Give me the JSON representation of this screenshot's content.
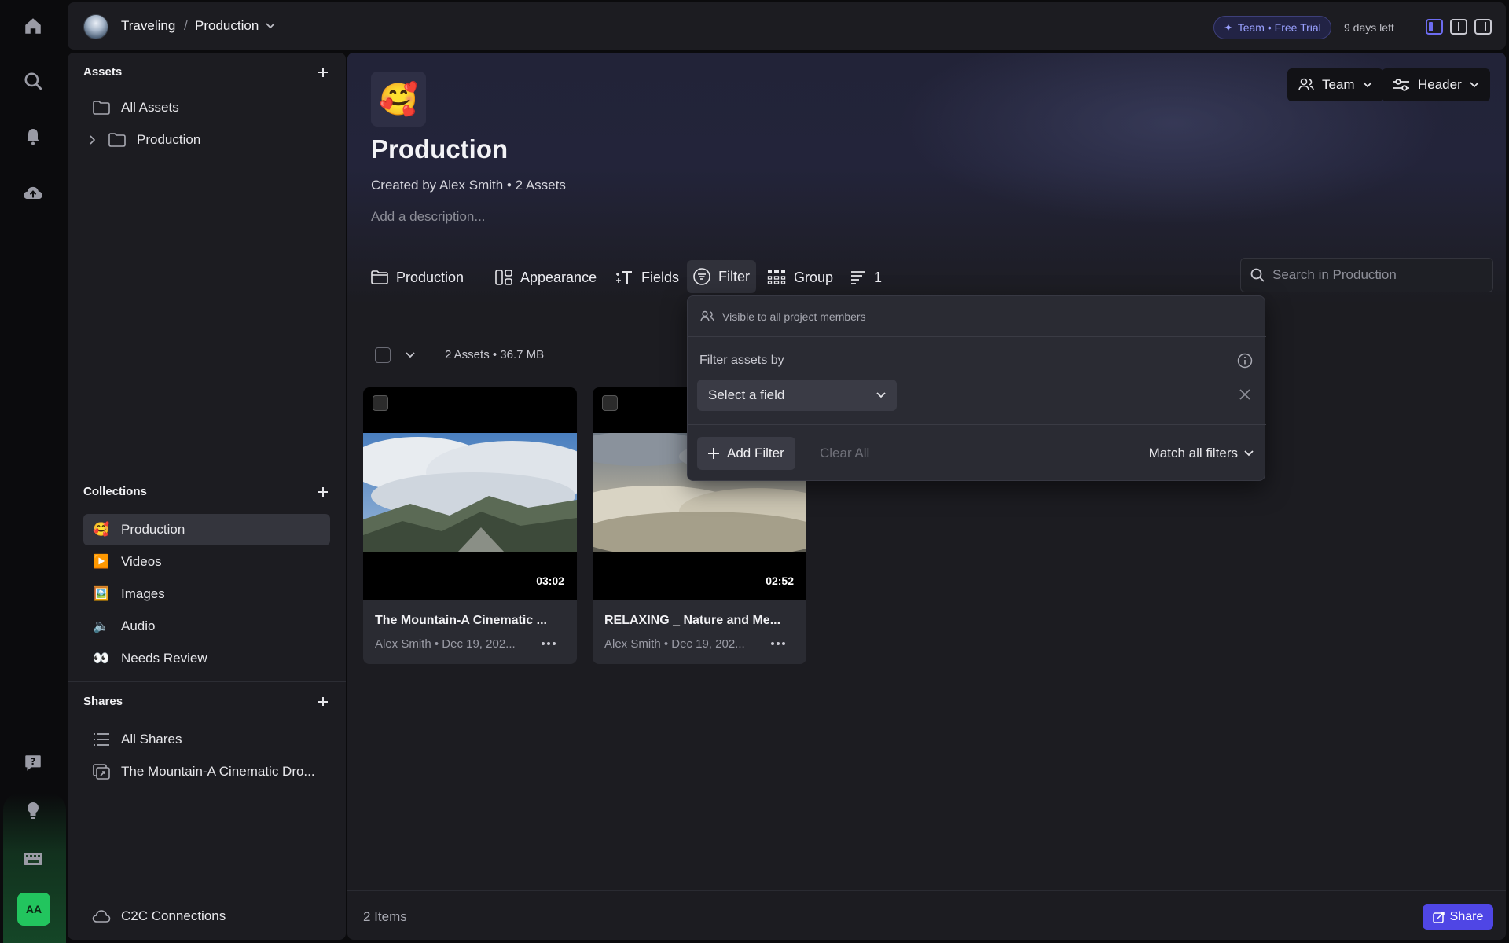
{
  "topbar": {
    "breadcrumb_root": "Traveling",
    "breadcrumb_sep": "/",
    "breadcrumb_current": "Production",
    "trial_badge": "Team • Free Trial",
    "days_left": "9 days left"
  },
  "rail": {
    "avatar_initials": "AA",
    "icons": [
      "home-icon",
      "search-icon",
      "bell-icon",
      "cloud-upload-icon",
      "help-icon",
      "lightbulb-icon",
      "keyboard-icon"
    ]
  },
  "sidebar": {
    "assets_title": "Assets",
    "assets_items": [
      {
        "label": "All Assets",
        "icon": "folder-icon"
      },
      {
        "label": "Production",
        "icon": "folder-icon"
      }
    ],
    "collections_title": "Collections",
    "collections_items": [
      {
        "label": "Production",
        "icon": "🥰"
      },
      {
        "label": "Videos",
        "icon": "▶️"
      },
      {
        "label": "Images",
        "icon": "🖼️"
      },
      {
        "label": "Audio",
        "icon": "🔈"
      },
      {
        "label": "Needs Review",
        "icon": "👀"
      }
    ],
    "shares_title": "Shares",
    "shares_items": [
      {
        "label": "All Shares",
        "icon": "list-icon"
      },
      {
        "label": "The Mountain-A Cinematic Dro...",
        "icon": "share-icon"
      }
    ],
    "c2c_label": "C2C Connections"
  },
  "main": {
    "emoji": "🥰",
    "title": "Production",
    "meta": "Created by Alex Smith • 2 Assets",
    "description_placeholder": "Add a description...",
    "team_button": "Team",
    "header_button": "Header",
    "toolbar": {
      "production": "Production",
      "appearance": "Appearance",
      "fields": "Fields",
      "filter": "Filter",
      "group": "Group",
      "sort_count": "1"
    },
    "search_placeholder": "Search in Production",
    "asset_summary": "2 Assets • 36.7 MB",
    "cards": [
      {
        "title": "The Mountain-A Cinematic ...",
        "subtitle": "Alex Smith • Dec 19, 202...",
        "duration": "03:02"
      },
      {
        "title": "RELAXING _ Nature and Me...",
        "subtitle": "Alex Smith • Dec 19, 202...",
        "duration": "02:52"
      }
    ],
    "items_count": "2 Items",
    "share_button": "Share"
  },
  "filter_popover": {
    "visibility": "Visible to all project members",
    "filter_label": "Filter assets by",
    "select_placeholder": "Select a field",
    "add_filter": "Add Filter",
    "clear_all": "Clear All",
    "match_mode": "Match all filters"
  }
}
